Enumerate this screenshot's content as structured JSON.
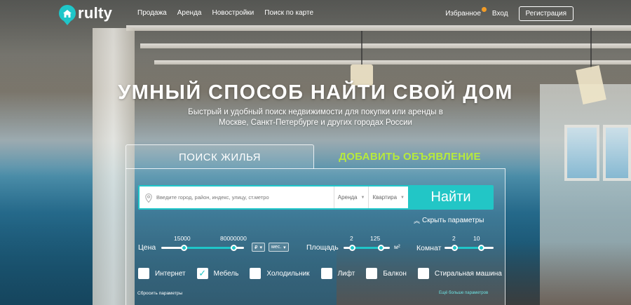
{
  "header": {
    "logo_text": "rulty",
    "nav": [
      "Продажа",
      "Аренда",
      "Новостройки",
      "Поиск по карте"
    ],
    "favorites": "Избранное",
    "login": "Вход",
    "register": "Регистрация"
  },
  "hero": {
    "title": "УМНЫЙ СПОСОБ НАЙТИ СВОЙ ДОМ",
    "subtitle_line1": "Быстрый и удобный поиск недвижимости для покупки или аренды в",
    "subtitle_line2": "Москве, Санкт-Петербурге и других городах России"
  },
  "tabs": {
    "search": "ПОИСК ЖИЛЬЯ",
    "add": "ДОБАВИТЬ ОБЪЯВЛЕНИЕ"
  },
  "search": {
    "placeholder": "Введите город, район, индекс, улицу, ст.метро",
    "deal_type": "Аренда",
    "property_type": "Квартира",
    "find_button": "Найти",
    "hide_params": "Скрыть параметры"
  },
  "filters": {
    "price": {
      "label": "Цена",
      "min": "15000",
      "max": "80000000",
      "min_fraction": 0.28,
      "max_fraction": 0.88,
      "currency": "₽",
      "period": "мес."
    },
    "area": {
      "label": "Площадь",
      "min": "2",
      "max": "125",
      "unit": "м²",
      "min_fraction": 0.2,
      "max_fraction": 0.82
    },
    "rooms": {
      "label": "Комнат",
      "min": "2",
      "max": "10",
      "min_fraction": 0.22,
      "max_fraction": 0.75
    }
  },
  "amenities": [
    {
      "label": "Интернет",
      "checked": false
    },
    {
      "label": "Мебель",
      "checked": true
    },
    {
      "label": "Холодильник",
      "checked": false
    },
    {
      "label": "Лифт",
      "checked": false
    },
    {
      "label": "Балкон",
      "checked": false
    },
    {
      "label": "Стиральная машина",
      "checked": false
    }
  ],
  "footer_links": {
    "reset": "Сбросить параметры",
    "more": "Ещё больше параметров"
  },
  "colors": {
    "accent": "#1fc6c9",
    "add_tab": "#b8ea3c",
    "fav_badge": "#f39c26"
  }
}
